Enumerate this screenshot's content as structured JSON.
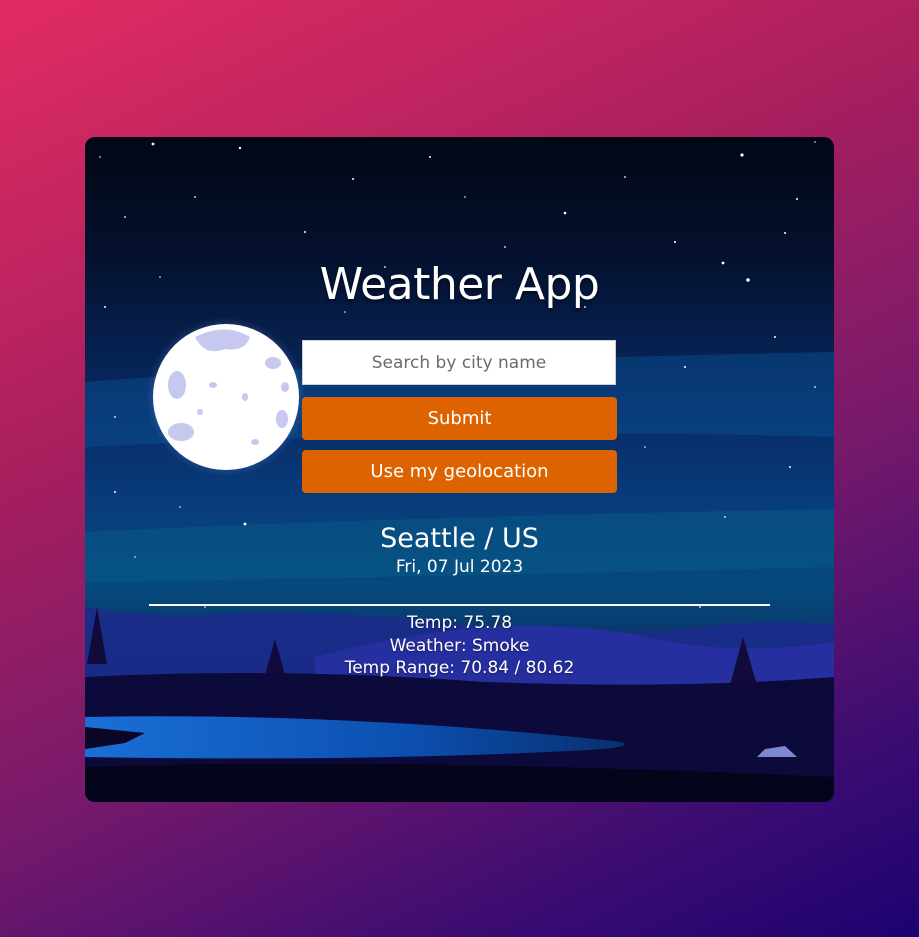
{
  "app": {
    "title": "Weather App"
  },
  "search": {
    "placeholder": "Search by city name",
    "value": ""
  },
  "buttons": {
    "submit_label": "Submit",
    "geolocation_label": "Use my geolocation"
  },
  "location": {
    "city": "Seattle / US",
    "date": "Fri, 07 Jul 2023"
  },
  "weather": {
    "temp": "Temp: 75.78",
    "condition": "Weather: Smoke",
    "range": "Temp Range: 70.84 / 80.62"
  },
  "colors": {
    "accent": "#dd6300",
    "page_gradient_start": "#e22c63",
    "page_gradient_end": "#1c0270"
  },
  "background": {
    "scene": "night-landscape-with-moon"
  }
}
